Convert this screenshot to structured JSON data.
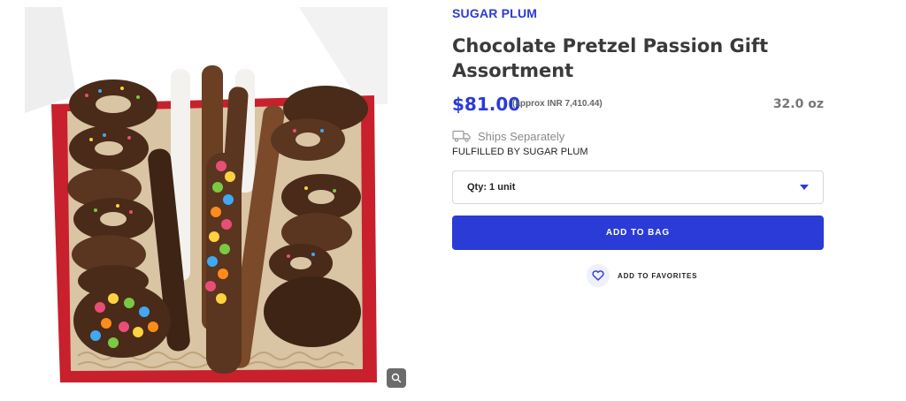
{
  "product": {
    "brand": "SUGAR PLUM",
    "title": "Chocolate Pretzel Passion Gift Assortment",
    "price": "$81.00",
    "approx_price": "(approx INR 7,410.44)",
    "weight": "32.0 oz",
    "shipping_note": "Ships Separately",
    "fulfilled_by": "FULFILLED BY SUGAR PLUM"
  },
  "quantity": {
    "selected": "Qty: 1 unit"
  },
  "actions": {
    "add_to_bag": "ADD TO BAG",
    "add_to_favorites": "ADD TO FAVORITES"
  },
  "icons": {
    "truck": "truck-icon",
    "heart": "heart-icon",
    "zoom": "magnify-icon",
    "caret": "caret-down-icon"
  },
  "colors": {
    "accent": "#2a3bd6",
    "chocolate": "#5a3520",
    "box_red": "#c8202c"
  }
}
